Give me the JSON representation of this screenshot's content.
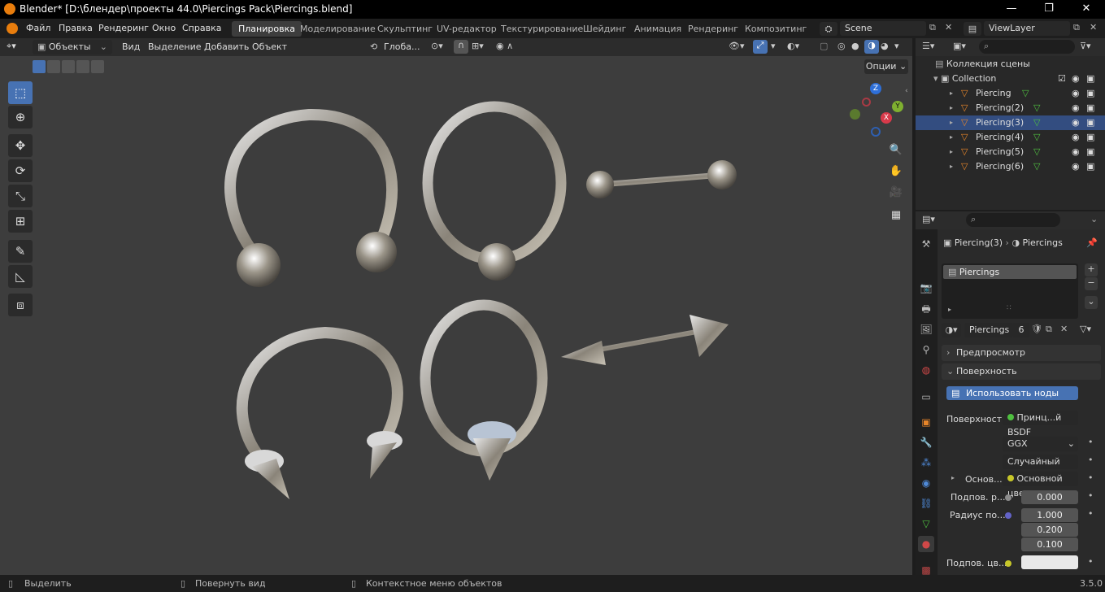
{
  "window": {
    "title": "Blender* [D:\\блендер\\проекты 44.0\\Piercings Pack\\Piercings.blend]",
    "minimize": "—",
    "maximize": "❐",
    "close": "✕"
  },
  "menu": {
    "items": [
      "Файл",
      "Правка",
      "Рендеринг",
      "Окно",
      "Справка"
    ]
  },
  "workspaces": {
    "tabs": [
      "Планировка",
      "Моделирование",
      "Скульптинг",
      "UV-редактор",
      "Текстурирование",
      "Шейдинг",
      "Анимация",
      "Рендеринг",
      "Композитинг"
    ],
    "active": "Планировка"
  },
  "scene": {
    "name": "Scene",
    "view_layer": "ViewLayer"
  },
  "viewport_header": {
    "mode": "Объекты",
    "menus": [
      "Вид",
      "Выделение",
      "Добавить",
      "Объект"
    ],
    "transform_orientation": "Глоба...",
    "options": "Опции"
  },
  "outliner": {
    "root": "Коллекция сцены",
    "collection": "Collection",
    "objects": [
      "Piercing",
      "Piercing(2)",
      "Piercing(3)",
      "Piercing(4)",
      "Piercing(5)",
      "Piercing(6)"
    ],
    "selected": "Piercing(3)"
  },
  "properties": {
    "breadcrumb_object": "Piercing(3)",
    "breadcrumb_material": "Piercings",
    "slot": "Piercings",
    "material_name": "Piercings",
    "users": "6",
    "panels": {
      "preview": "Предпросмотр",
      "surface": "Поверхность"
    },
    "use_nodes": "Использовать ноды",
    "surface_label": "Поверхность",
    "surface_value": "Принц...й BSDF",
    "distribution": "GGX",
    "subsurface_method": "Случайный об...",
    "base_label": "Основ...",
    "base_value": "Основной цвет",
    "subsurface_label": "Подпов. р...",
    "subsurface_value": "0.000",
    "radius_label": "Радиус по...",
    "radius_values": [
      "1.000",
      "0.200",
      "0.100"
    ],
    "subsurface_color_label": "Подпов. цв..."
  },
  "status": {
    "select": "Выделить",
    "rotate": "Повернуть вид",
    "context": "Контекстное меню объектов",
    "version": "3.5.0"
  },
  "gizmo": {
    "x": "X",
    "y": "Y",
    "z": "Z"
  },
  "colors": {
    "accent": "#4772b3",
    "selected_row": "#334d80",
    "orange": "#e87d0d"
  }
}
